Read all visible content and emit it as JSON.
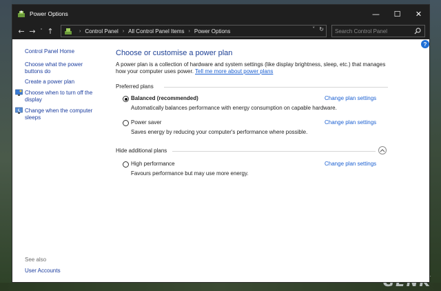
{
  "window": {
    "title": "Power Options",
    "controls": {
      "minimize": "—",
      "maximize": "☐",
      "close": "✕"
    }
  },
  "nav": {
    "back": "←",
    "forward": "→",
    "recent": "˅",
    "up": "↑",
    "breadcrumbs": [
      "Control Panel",
      "All Control Panel Items",
      "Power Options"
    ],
    "separator": "›",
    "dropdown": "˅",
    "refresh": "↻",
    "search_placeholder": "Search Control Panel"
  },
  "left_pane": {
    "home": "Control Panel Home",
    "links": [
      {
        "label": "Choose what the power buttons do",
        "icon": ""
      },
      {
        "label": "Create a power plan",
        "icon": ""
      },
      {
        "label": "Choose when to turn off the display",
        "icon": "monitor-icon"
      },
      {
        "label": "Change when the computer sleeps",
        "icon": "sleep-icon"
      }
    ],
    "see_also": "See also",
    "user_accounts": "User Accounts"
  },
  "main": {
    "heading": "Choose or customise a power plan",
    "intro": "A power plan is a collection of hardware and system settings (like display brightness, sleep, etc.) that manages how your computer uses power.",
    "intro_link": "Tell me more about power plans",
    "preferred_label": "Preferred plans",
    "hidden_label": "Hide additional plans",
    "change_link": "Change plan settings",
    "help": "?",
    "plans": [
      {
        "name": "Balanced (recommended)",
        "description": "Automatically balances performance with energy consumption on capable hardware.",
        "selected": true
      },
      {
        "name": "Power saver",
        "description": "Saves energy by reducing your computer's performance where possible.",
        "selected": false
      },
      {
        "name": "High performance",
        "description": "Favours performance but may use more energy.",
        "selected": false
      }
    ]
  },
  "watermark": "GENK",
  "colors": {
    "titlebar": "#1f1f1f",
    "link": "#1a5fd1",
    "heading": "#1c3f94",
    "help": "#1f6fd6"
  }
}
